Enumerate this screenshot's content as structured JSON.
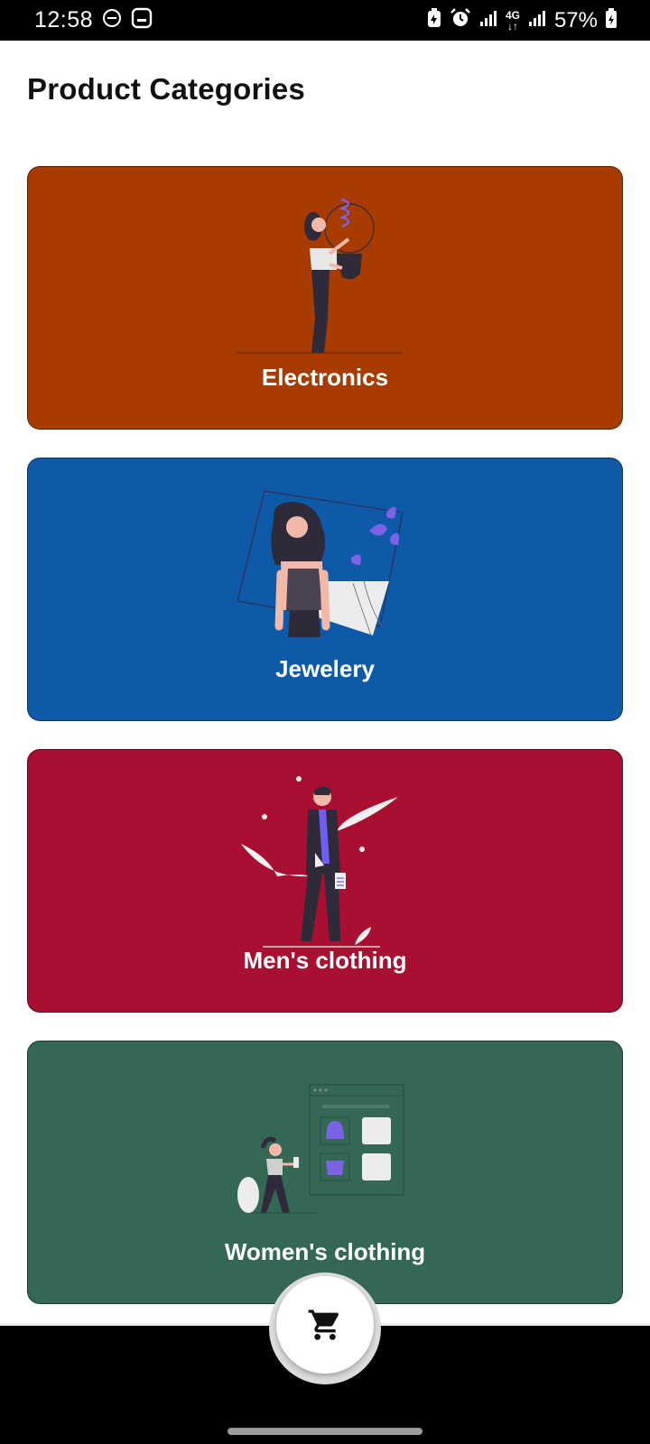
{
  "status_bar": {
    "time": "12:58",
    "network": "4G",
    "battery": "57%",
    "icons": [
      "do-not-disturb-icon",
      "screenshot-icon",
      "battery-saver-icon",
      "alarm-icon",
      "signal-icon",
      "network-4g-icon",
      "signal-icon",
      "battery-icon"
    ]
  },
  "header": {
    "title": "Product Categories"
  },
  "categories": [
    {
      "label": "Electronics",
      "color": "#A83C00",
      "illustration": "woman-lightbulb-illustration"
    },
    {
      "label": "Jewelery",
      "color": "#0F5AA8",
      "illustration": "woman-necklace-illustration"
    },
    {
      "label": "Men's clothing",
      "color": "#A80F30",
      "illustration": "man-walking-illustration"
    },
    {
      "label": "Women's clothing",
      "color": "#346855",
      "illustration": "woman-shopping-illustration"
    }
  ],
  "fab": {
    "icon": "shopping-cart-icon"
  }
}
